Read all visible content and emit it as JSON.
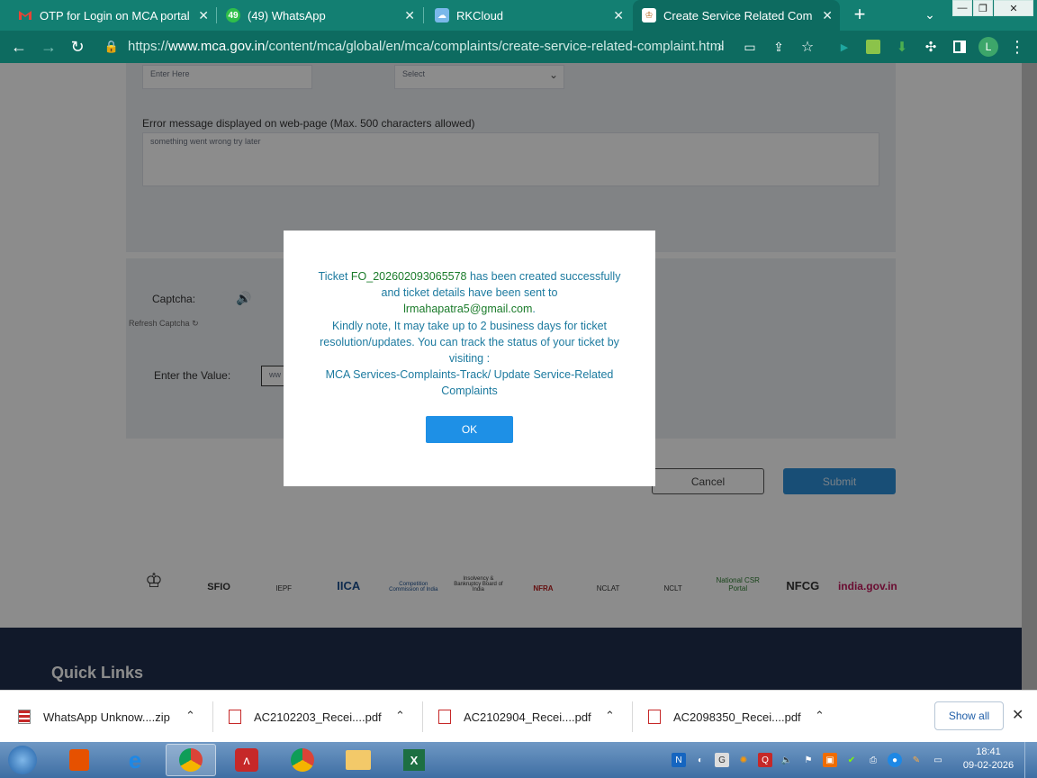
{
  "browser": {
    "tabs": [
      {
        "title": "OTP for Login on MCA portal -",
        "favicon": "gmail-icon"
      },
      {
        "title": "(49) WhatsApp",
        "badge": "49",
        "favicon": "whatsapp-icon"
      },
      {
        "title": "RKCloud",
        "favicon": "cloud-icon"
      },
      {
        "title": "Create Service Related Complai",
        "favicon": "mca-emblem-icon",
        "active": true
      }
    ],
    "url_prefix": "https://",
    "url_domain": "www.mca.gov.in",
    "url_path": "/content/mca/global/en/mca/complaints/create-service-related-complaint.html",
    "profile_initial": "L"
  },
  "form": {
    "enter_here_placeholder": "Enter Here",
    "select_placeholder": "Select",
    "error_label": "Error message displayed on web-page (Max. 500 characters allowed)",
    "error_value": "something went wrong try later",
    "captcha_label": "Captcha:",
    "refresh_captcha": "Refresh Captcha",
    "enter_value_label": "Enter the Value:",
    "enter_value_partial": "ww",
    "cancel_label": "Cancel",
    "submit_label": "Submit"
  },
  "logos": [
    "SFIO",
    "IEPF",
    "IICA",
    "Competition Commission of India",
    "Insolvency & Bankruptcy Board of India",
    "NFRA",
    "NCLAT",
    "NCLT",
    "National CSR Portal",
    "NFCG",
    "india.gov.in"
  ],
  "footer": {
    "quick_links": "Quick Links"
  },
  "modal": {
    "ticket_prefix": "Ticket",
    "ticket_id": "FO_202602093065578",
    "line1_rest": "has been created successfully and ticket details have been sent to",
    "email": "lrmahapatra5@gmail.com",
    "email_suffix": ".",
    "note": "Kindly note, It may take up to 2 business days for ticket resolution/updates. You can track the status of your ticket by visiting :",
    "track_link": "MCA Services-Complaints-Track/ Update Service-Related Complaints",
    "ok_label": "OK"
  },
  "downloads": {
    "items": [
      {
        "name": "WhatsApp Unknow....zip",
        "icon": "zip-icon"
      },
      {
        "name": "AC2102203_Recei....pdf",
        "icon": "pdf-icon"
      },
      {
        "name": "AC2102904_Recei....pdf",
        "icon": "pdf-icon"
      },
      {
        "name": "AC2098350_Recei....pdf",
        "icon": "pdf-icon"
      }
    ],
    "show_all": "Show all"
  },
  "taskbar": {
    "time": "18:41",
    "date": "09-02-2026"
  },
  "colors": {
    "accent_teal": "#137f72",
    "toolbar_teal": "#0d6b60",
    "ok_blue": "#1e90e6",
    "ticket_green": "#1a7b2a"
  }
}
